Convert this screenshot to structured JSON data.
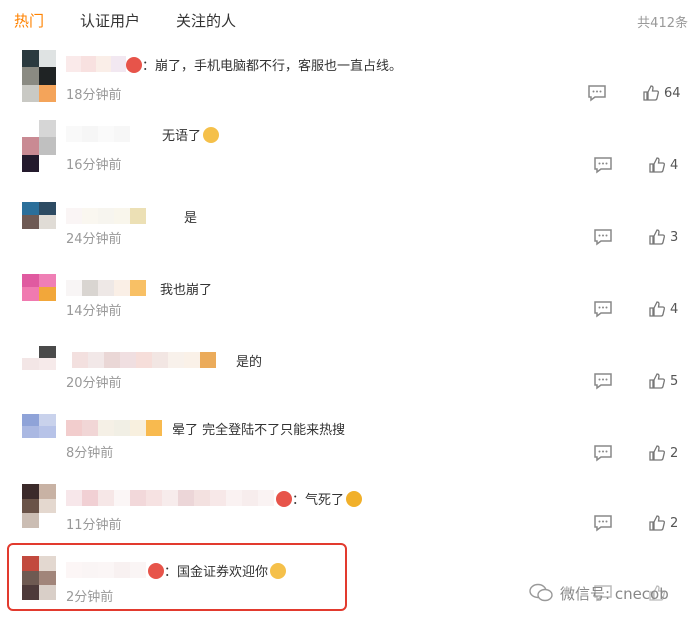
{
  "tabs": [
    {
      "label": "热门",
      "active": true
    },
    {
      "label": "认证用户",
      "active": false
    },
    {
      "label": "关注的人",
      "active": false
    }
  ],
  "total_count": "共412条",
  "comments": [
    {
      "text": "：崩了，手机电脑都不行，客服也一直占线。",
      "time": "18分钟前",
      "likes": "64",
      "emoji": "none"
    },
    {
      "text": "无语了",
      "time": "16分钟前",
      "likes": "4",
      "emoji": "sweat"
    },
    {
      "text": "是",
      "time": "24分钟前",
      "likes": "3",
      "emoji": "none"
    },
    {
      "text": "我也崩了",
      "time": "14分钟前",
      "likes": "4",
      "emoji": "none"
    },
    {
      "text": "是的",
      "time": "20分钟前",
      "likes": "5",
      "emoji": "none"
    },
    {
      "text": "晕了 完全登陆不了只能来热搜",
      "time": "8分钟前",
      "likes": "2",
      "emoji": "none"
    },
    {
      "text": "：气死了",
      "time": "11分钟前",
      "likes": "2",
      "emoji": "cry"
    },
    {
      "text": "：国金证券欢迎你",
      "time": "2分钟前",
      "likes": "",
      "emoji": "laugh"
    }
  ],
  "watermark": "微信号: cnecob",
  "colors": {
    "accent": "#ff8200",
    "highlight": "#e23a2e"
  }
}
